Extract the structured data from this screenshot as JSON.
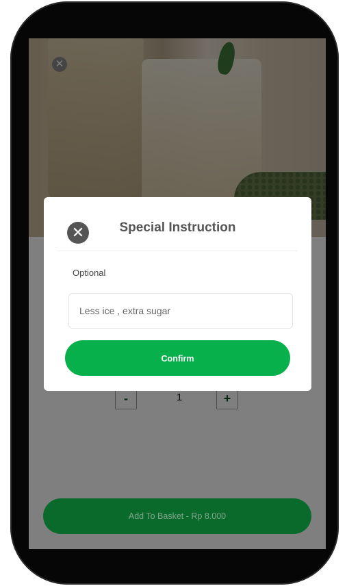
{
  "modal": {
    "title": "Special Instruction",
    "close_glyph": "✕",
    "close_icon": "close-circle-icon",
    "optional_label": "Optional",
    "input_value": "",
    "input_placeholder": "Less ice , extra sugar",
    "confirm_label": "Confirm"
  },
  "hero": {
    "close_glyph": "✕",
    "close_icon": "close-circle-icon"
  },
  "stepper": {
    "minus_label": "-",
    "quantity": "1",
    "plus_label": "+"
  },
  "basket": {
    "button_label": "Add To Basket - Rp 8.000"
  },
  "colors": {
    "primary_green": "#07b04b",
    "overlay": "rgba(0,0,0,0.5)",
    "title_gray": "#555555"
  }
}
